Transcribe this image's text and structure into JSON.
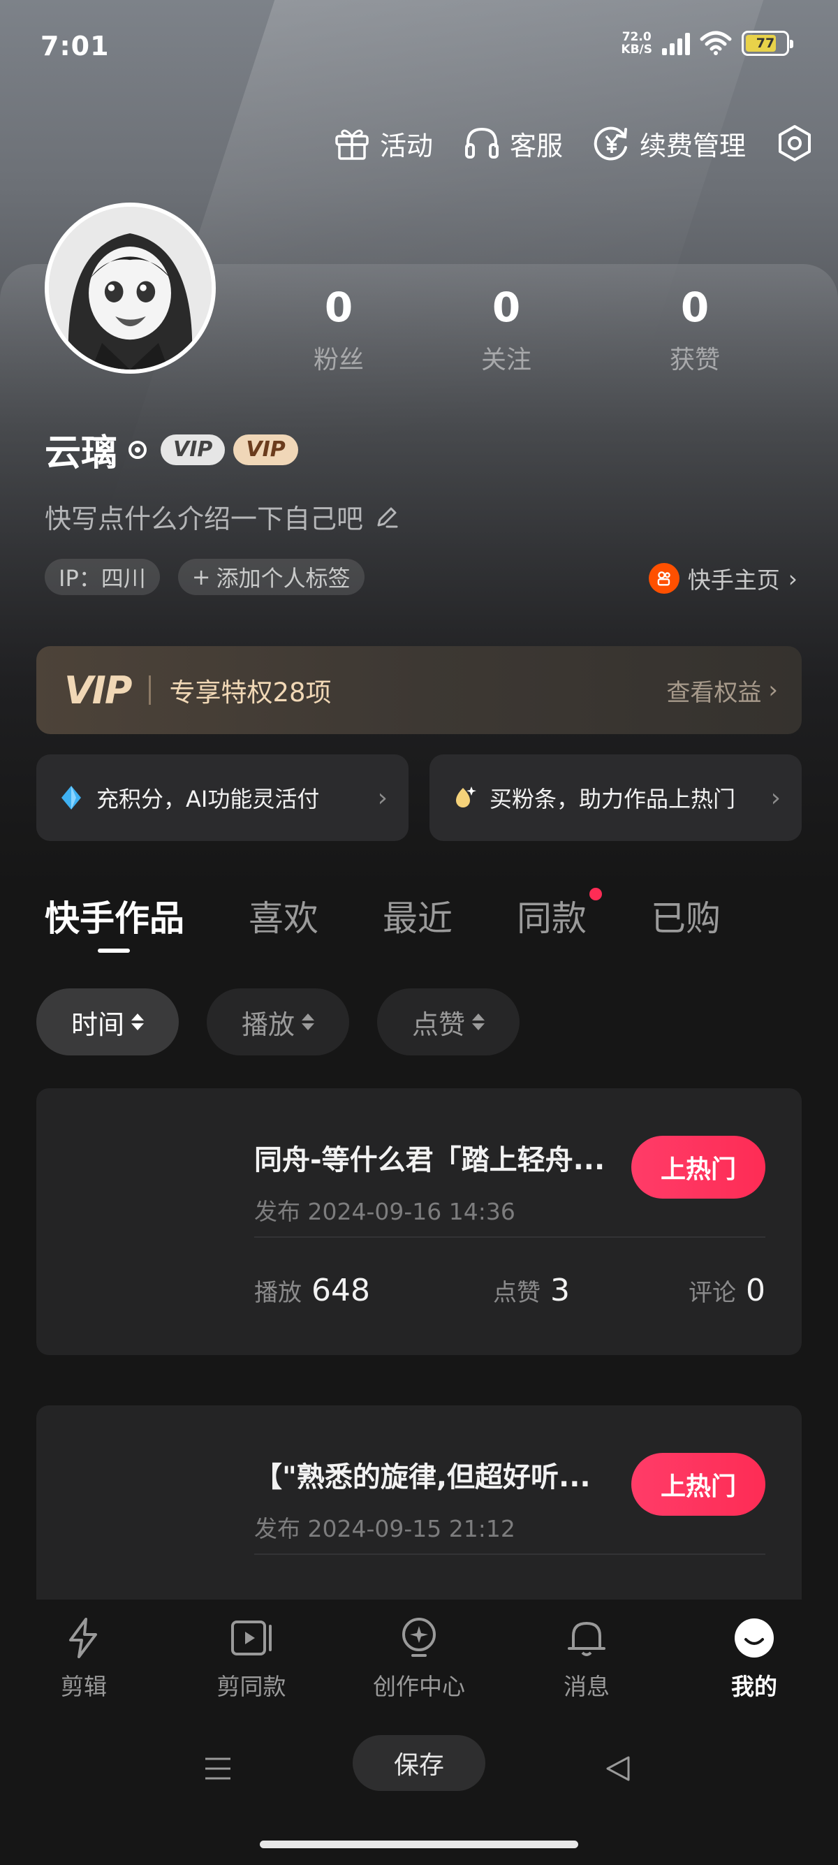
{
  "status_bar": {
    "time": "7:01",
    "net_speed_value": "72.0",
    "net_speed_unit": "KB/S",
    "battery": "77"
  },
  "top_menu": [
    {
      "label": "活动",
      "icon": "gift-icon"
    },
    {
      "label": "客服",
      "icon": "headset-icon"
    },
    {
      "label": "续费管理",
      "icon": "renew-yen-icon"
    },
    {
      "label": "",
      "icon": "settings-icon"
    }
  ],
  "profile": {
    "username": "云璃",
    "vip_badge_1": "VIP",
    "vip_badge_2": "VIP",
    "bio": "快写点什么介绍一下自己吧",
    "ip_tag": "IP：四川",
    "add_tag": "添加个人标签",
    "kuaishou_link": "快手主页",
    "stats": [
      {
        "value": "0",
        "label": "粉丝"
      },
      {
        "value": "0",
        "label": "关注"
      },
      {
        "value": "0",
        "label": "获赞"
      }
    ]
  },
  "vip_banner": {
    "logo": "VIP",
    "text": "专享特权28项",
    "more": "查看权益"
  },
  "promos": [
    {
      "text": "充积分，AI功能灵活付",
      "icon": "diamond-icon"
    },
    {
      "text": "买粉条，助力作品上热门",
      "icon": "flame-icon"
    }
  ],
  "tabs": [
    "快手作品",
    "喜欢",
    "最近",
    "同款",
    "已购"
  ],
  "sort_options": [
    "时间",
    "播放",
    "点赞"
  ],
  "works": [
    {
      "title": "同舟-等什么君「踏上轻舟...",
      "date": "发布 2024-09-16 14:36",
      "button": "上热门",
      "metrics": [
        {
          "label": "播放",
          "value": "648"
        },
        {
          "label": "点赞",
          "value": "3"
        },
        {
          "label": "评论",
          "value": "0"
        }
      ]
    },
    {
      "title": "【\"熟悉的旋律,但超好听...",
      "date": "发布 2024-09-15 21:12",
      "button": "上热门"
    }
  ],
  "bottom_nav": [
    {
      "label": "剪辑",
      "icon": "lightning-icon"
    },
    {
      "label": "剪同款",
      "icon": "video-template-icon"
    },
    {
      "label": "创作中心",
      "icon": "bulb-icon"
    },
    {
      "label": "消息",
      "icon": "bell-icon"
    },
    {
      "label": "我的",
      "icon": "smile-icon",
      "active": true
    }
  ],
  "system_bar": {
    "save": "保存"
  }
}
